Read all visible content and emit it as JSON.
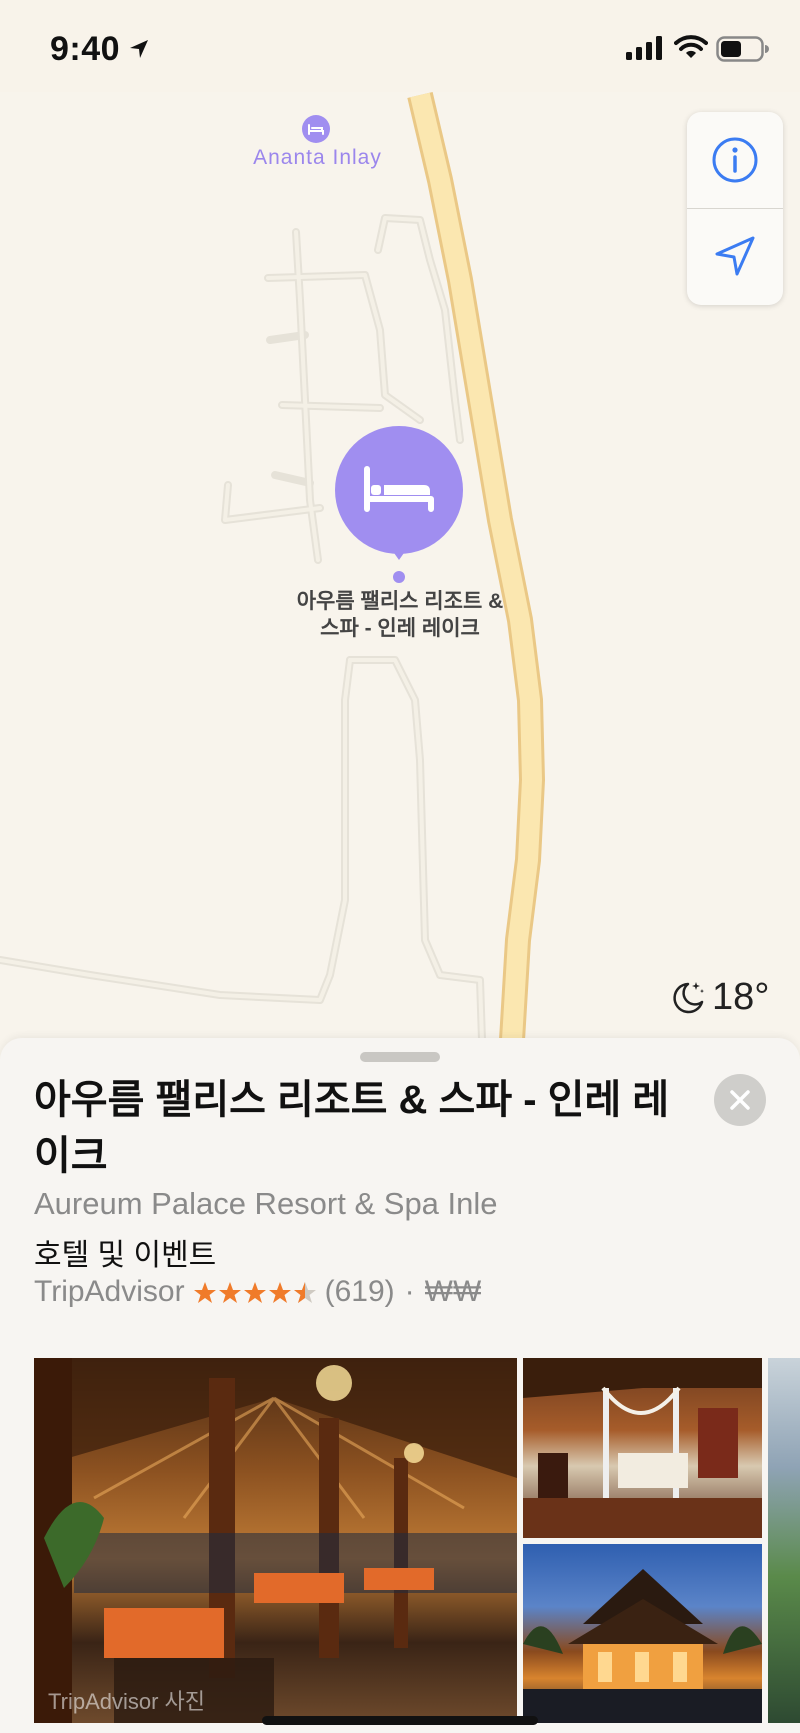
{
  "status_bar": {
    "time": "9:40"
  },
  "map": {
    "nearby_poi": {
      "label": "Ananta Inlay",
      "icon": "bed-icon"
    },
    "selected_poi": {
      "label_line1": "아우름 팰리스 리조트 &",
      "label_line2": "스파 - 인레 레이크",
      "icon": "bed-icon",
      "color": "#a08ef0"
    },
    "weather": {
      "icon": "moon-stars-icon",
      "temperature": "18°"
    }
  },
  "place_card": {
    "title": "아우름 팰리스 리조트 & 스파 - 인레 레이크",
    "subtitle": "Aureum Palace Resort & Spa Inle",
    "category": "호텔 및 이벤트",
    "rating": {
      "source": "TripAdvisor",
      "stars": 4.5,
      "count": "(619)",
      "separator": "·",
      "price": "₩₩",
      "star_color": "#f07b2a"
    },
    "photo_credit": "TripAdvisor 사진"
  },
  "colors": {
    "accent": "#3b7cf2",
    "poi": "#a08ef0",
    "road_main": "#fbe7b0"
  }
}
